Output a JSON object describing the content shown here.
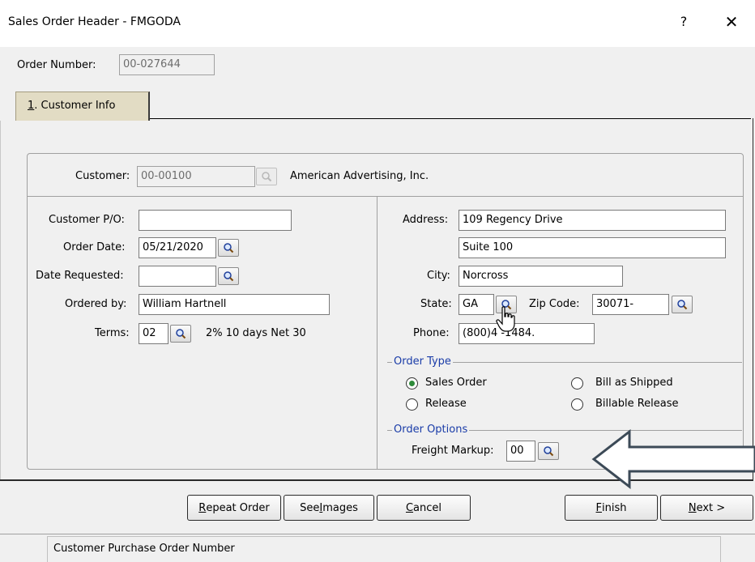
{
  "window": {
    "title": "Sales Order Header - FMGODA",
    "help_label": "?",
    "close_label": "✕"
  },
  "order": {
    "number_label": "Order Number:",
    "number_value": "00-027644"
  },
  "tab": {
    "accel": "1",
    "label": ". Customer Info"
  },
  "customer": {
    "label": "Customer:",
    "id": "00-00100",
    "name": "American Advertising, Inc."
  },
  "left": {
    "po_label": "Customer P/O:",
    "po_value": "",
    "order_date_label": "Order Date:",
    "order_date_value": "05/21/2020",
    "date_requested_label": "Date Requested:",
    "date_requested_value": "",
    "ordered_by_label": "Ordered by:",
    "ordered_by_value": "William Hartnell",
    "terms_label": "Terms:",
    "terms_value": "02",
    "terms_desc": "2% 10 days Net 30"
  },
  "right": {
    "address_label": "Address:",
    "address1": "109 Regency Drive",
    "address2": "Suite 100",
    "city_label": "City:",
    "city_value": "Norcross",
    "state_label": "State:",
    "state_value": "GA",
    "zip_label": "Zip Code:",
    "zip_value": "30071-",
    "phone_label": "Phone:",
    "phone_value": "(800)4  -1484."
  },
  "order_type": {
    "title": "Order Type",
    "sales_order": "Sales Order",
    "release": "Release",
    "bill_as_shipped": "Bill as Shipped",
    "billable_release": "Billable Release",
    "selected": "Sales Order"
  },
  "order_options": {
    "title": "Order Options",
    "freight_markup_label": "Freight Markup:",
    "freight_markup_value": "00"
  },
  "buttons": {
    "repeat_accel": "R",
    "repeat_rest": "epeat Order",
    "images_pre": "See ",
    "images_accel": "I",
    "images_rest": "mages",
    "cancel_accel": "C",
    "cancel_rest": "ancel",
    "finish_accel": "F",
    "finish_rest": "inish",
    "next_accel": "N",
    "next_rest": "ext >"
  },
  "status": {
    "text": "Customer Purchase Order Number"
  },
  "colors": {
    "accent_blue": "#1a3ca8",
    "tab_bg": "#e2dcc4",
    "radio_selected": "#2e8b3a"
  }
}
